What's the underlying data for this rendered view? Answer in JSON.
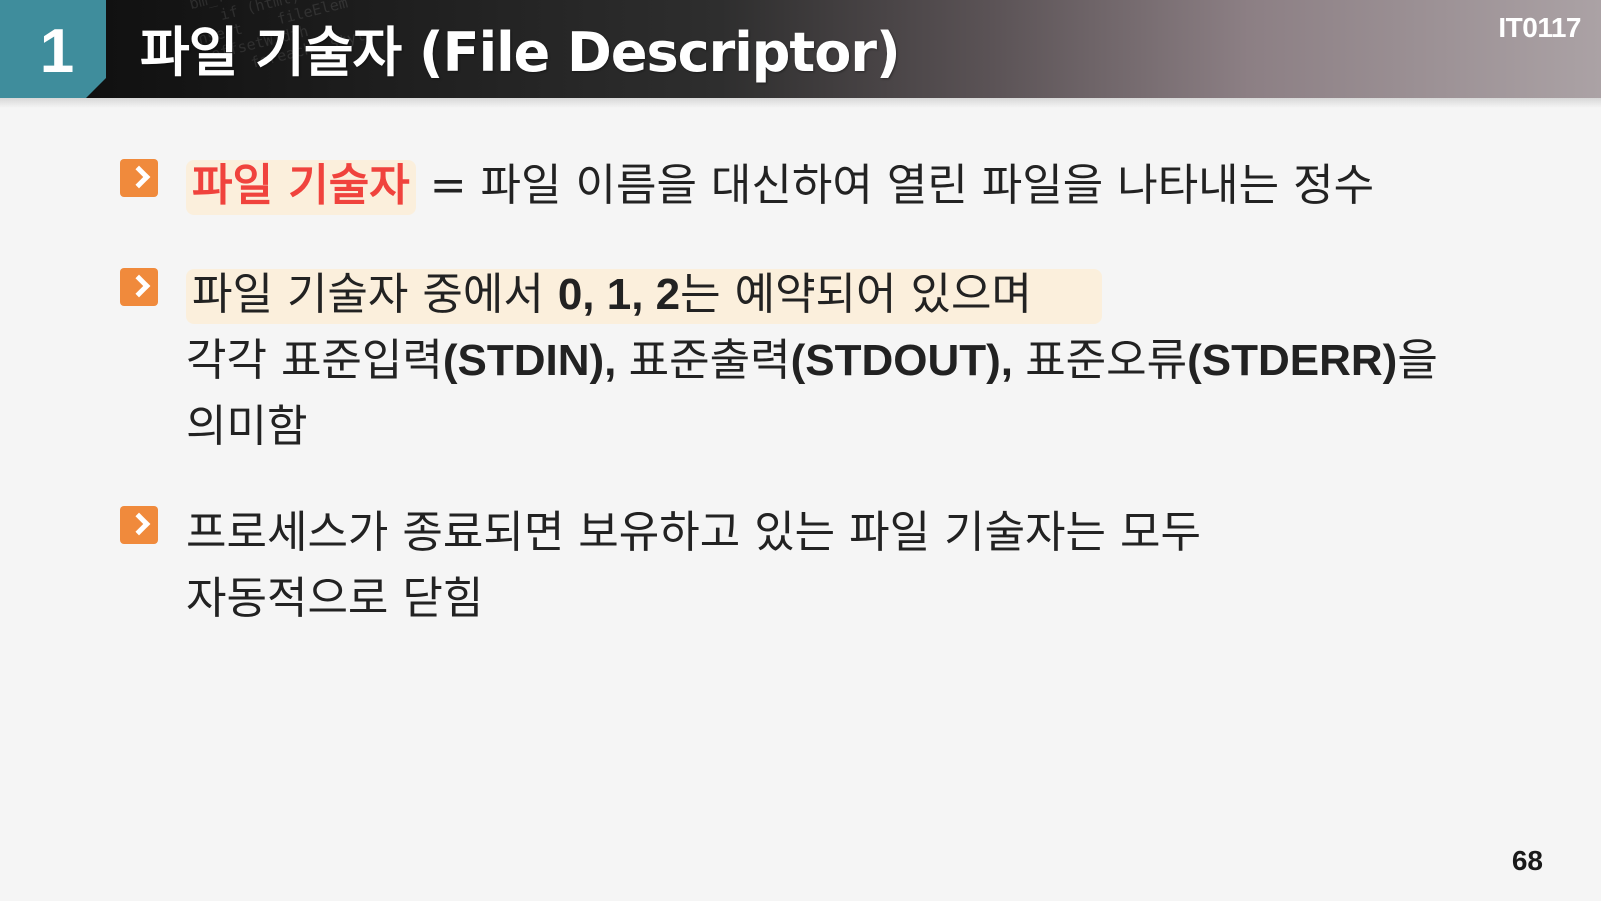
{
  "header": {
    "number": "1",
    "title": "파일 기술자 (File Descriptor)",
    "course_code": "IT0117"
  },
  "bullets": [
    {
      "term": "파일 기술자",
      "rest": " = 파일 이름을 대신하여 열린 파일을 나타내는 정수"
    },
    {
      "line1_a": "파일 기술자 중에서 ",
      "line1_b": "0, 1, 2",
      "line1_c": "는 예약되어 있으며",
      "line2_a": "각각 표준입력",
      "line2_b": "(STDIN), ",
      "line2_c": "표준출력",
      "line2_d": "(STDOUT), ",
      "line2_e": "표준오류",
      "line2_f": "(STDERR)",
      "line2_g": "을",
      "line3": "의미함"
    },
    {
      "line1": "프로세스가 종료되면 보유하고 있는 파일 기술자는 모두",
      "line2": "자동적으로 닫힘"
    }
  ],
  "page_number": "68",
  "colors": {
    "accent_teal": "#3f8d9c",
    "bullet_orange": "#f08a3c",
    "term_red": "#f0433d",
    "highlight": "#fbefdc"
  },
  "icons": {
    "bullet": "chevron-right-icon"
  }
}
